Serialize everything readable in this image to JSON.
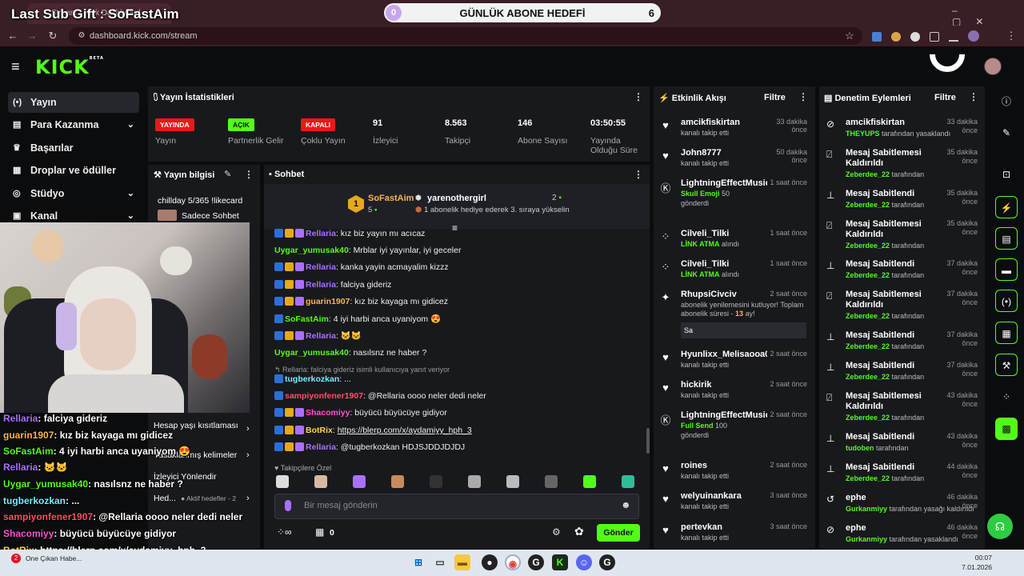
{
  "browser": {
    "tab_title": "Stream - Kick Dashboard",
    "url": "dashboard.kick.com/stream"
  },
  "overlay": {
    "sub_gift": "Last Sub Gift : SoFastAim",
    "goal_left": "0",
    "goal_title": "GÜNLÜK ABONE HEDEFİ",
    "goal_right": "6"
  },
  "sidebar": {
    "items": [
      {
        "label": "Yayın",
        "icon": "broadcast-icon"
      },
      {
        "label": "Para Kazanma",
        "icon": "wallet-icon"
      },
      {
        "label": "Başarılar",
        "icon": "trophy-icon"
      },
      {
        "label": "Droplar ve ödüller",
        "icon": "gift-icon"
      },
      {
        "label": "Stüdyo",
        "icon": "studio-icon"
      },
      {
        "label": "Kanal",
        "icon": "channel-icon"
      }
    ]
  },
  "stats": {
    "title": "Yayın İstatistikleri",
    "items": [
      {
        "tag": "YAYINDA",
        "label": "Yayın"
      },
      {
        "tag": "AÇIK",
        "label": "Partnerlik Gelir"
      },
      {
        "tag": "KAPALI",
        "label": "Çoklu Yayın"
      },
      {
        "value": "91",
        "label": "İzleyici"
      },
      {
        "value": "8.563",
        "label": "Takipçi"
      },
      {
        "value": "146",
        "label": "Abone Sayısı"
      },
      {
        "value": "03:50:55",
        "label": "Yayında Olduğu Süre"
      }
    ]
  },
  "stream_info": {
    "title": "Yayın bilgisi",
    "stream_title": "chillday 5/365 !likecard",
    "mode": "Sadece Sohbet",
    "links": [
      "Hesap yaşı kısıtlaması",
      "Yasaklanmış kelimeler",
      "İzleyici Yönlendir",
      "Hed...",
      "Aktif hedefler - 2"
    ]
  },
  "chat": {
    "title": "Sohbet",
    "leader1": "SoFastAim",
    "leader1_rank": "1",
    "leader1_count": "5",
    "leader2": "yarenothergirl",
    "leader2_count": "2",
    "leader_note": "1 abonelik hediye ederek 3. sıraya yükselin",
    "messages": [
      {
        "user": "Rellaria",
        "color": "#a970ff",
        "text": "kız biz yayın mı acıcaz"
      },
      {
        "user": "Uygar_yumusak40",
        "color": "#53fc18",
        "text": "Mrblar iyi yayınlar, iyi geceler"
      },
      {
        "user": "Rellaria",
        "color": "#a970ff",
        "text": "kanka yayin acmayalim kizzz"
      },
      {
        "user": "Rellaria",
        "color": "#a970ff",
        "text": "falciya gideriz"
      },
      {
        "user": "guarin1907",
        "color": "#ffb24d",
        "text": "kız biz kayaga mı gidicez"
      },
      {
        "user": "SoFastAim",
        "color": "#53fc18",
        "text": "4 iyi harbi anca uyaniyom 😍"
      },
      {
        "user": "Rellaria",
        "color": "#a970ff",
        "text": "🐱🐱"
      },
      {
        "user": "Uygar_yumusak40",
        "color": "#53fc18",
        "text": "nasılsnz ne haber ?"
      },
      {
        "user": "tugberkozkan",
        "color": "#79e8ff",
        "text": "..."
      },
      {
        "user": "sampiyonfener1907",
        "color": "#ff4f64",
        "text": "@Rellaria oooo neler dedi neler"
      },
      {
        "user": "Shacomiyy",
        "color": "#ff4fd2",
        "text": "büyücü büyücüye gidiyor"
      },
      {
        "user": "BotRix",
        "color": "#ffd23f",
        "text": "https://blerp.com/x/aydamiyy_hph_3"
      },
      {
        "user": "Rellaria",
        "color": "#a970ff",
        "text": "@tugberkozkan HDJSJDDJDJDJ"
      }
    ],
    "reply_note": "Rellaria: falciya gideriz isimli kullanıcıya yanıt veriyor",
    "followers_label": "Takipçilere Özel",
    "input_placeholder": "Bir mesaj gönderin",
    "points": "0",
    "send_label": "Gönder"
  },
  "activity": {
    "title": "Etkinlik Akışı",
    "filter": "Filtre",
    "items": [
      {
        "name": "amcikfiskirtan",
        "sub": "kanalı takip etti",
        "time": "33 dakika önce",
        "icon": "heart-icon"
      },
      {
        "name": "John8777",
        "sub": "kanalı takip etti",
        "time": "50 dakika önce",
        "icon": "heart-icon"
      },
      {
        "name": "LightningEffectMusic",
        "sub1": "Skull Emoji",
        "sub2": "50",
        "sub3": "gönderdi",
        "time": "1 saat önce",
        "icon": "kick-icon"
      },
      {
        "name": "Cilveli_Tilki",
        "sub1": "LİNK ATMA",
        "sub2": "alındı",
        "time": "1 saat önce",
        "icon": "points-icon"
      },
      {
        "name": "Cilveli_Tilki",
        "sub1": "LİNK ATMA",
        "sub2": "alındı",
        "time": "1 saat önce",
        "icon": "points-icon"
      },
      {
        "name": "RhupsiCivciv",
        "sub": "abonelik yenilemesini kutluyor! Toplam abonelik süresi -",
        "months": "13",
        "sub_end": "ay!",
        "message": "Sa",
        "time": "2 saat önce",
        "icon": "star-icon"
      },
      {
        "name": "Hyunlixx_Melisaooa00",
        "sub": "kanalı takip etti",
        "time": "2 saat önce",
        "icon": "heart-icon"
      },
      {
        "name": "hickirik",
        "sub": "kanalı takip etti",
        "time": "2 saat önce",
        "icon": "heart-icon"
      },
      {
        "name": "LightningEffectMusic",
        "sub1": "Full Send",
        "sub2": "100",
        "sub3": "gönderdi",
        "time": "2 saat önce",
        "icon": "kick-icon"
      },
      {
        "name": "roines",
        "sub": "kanalı takip etti",
        "time": "2 saat önce",
        "icon": "heart-icon"
      },
      {
        "name": "welyuinankara",
        "sub": "kanalı takip etti",
        "time": "3 saat önce",
        "icon": "heart-icon"
      },
      {
        "name": "pertevkan",
        "sub": "kanalı takip etti",
        "time": "3 saat önce",
        "icon": "heart-icon"
      }
    ]
  },
  "moderation": {
    "title": "Denetim Eylemleri",
    "filter": "Filtre",
    "items": [
      {
        "name": "amcikfiskirtan",
        "by": "THEYUPS",
        "suffix": "tarafından yasaklandı",
        "time": "33 dakika önce",
        "icon": "ban-icon"
      },
      {
        "name": "Mesaj Sabitlemesi Kaldırıldı",
        "by": "Zeberdee_22",
        "suffix": "tarafından",
        "time": "35 dakika önce",
        "icon": "unpin-icon"
      },
      {
        "name": "Mesaj Sabitlendi",
        "by": "Zeberdee_22",
        "suffix": "tarafından",
        "time": "35 dakika önce",
        "icon": "pin-icon"
      },
      {
        "name": "Mesaj Sabitlemesi Kaldırıldı",
        "by": "Zeberdee_22",
        "suffix": "tarafından",
        "time": "35 dakika önce",
        "icon": "unpin-icon"
      },
      {
        "name": "Mesaj Sabitlendi",
        "by": "Zeberdee_22",
        "suffix": "tarafından",
        "time": "37 dakika önce",
        "icon": "pin-icon"
      },
      {
        "name": "Mesaj Sabitlemesi Kaldırıldı",
        "by": "Zeberdee_22",
        "suffix": "tarafından",
        "time": "37 dakika önce",
        "icon": "unpin-icon"
      },
      {
        "name": "Mesaj Sabitlendi",
        "by": "Zeberdee_22",
        "suffix": "tarafından",
        "time": "37 dakika önce",
        "icon": "pin-icon"
      },
      {
        "name": "Mesaj Sabitlendi",
        "by": "Zeberdee_22",
        "suffix": "tarafından",
        "time": "37 dakika önce",
        "icon": "pin-icon"
      },
      {
        "name": "Mesaj Sabitlemesi Kaldırıldı",
        "by": "Zeberdee_22",
        "suffix": "tarafından",
        "time": "43 dakika önce",
        "icon": "unpin-icon"
      },
      {
        "name": "Mesaj Sabitlendi",
        "by": "tudoben",
        "suffix": "tarafından",
        "time": "43 dakika önce",
        "icon": "pin-icon"
      },
      {
        "name": "Mesaj Sabitlendi",
        "by": "Zeberdee_22",
        "suffix": "tarafından",
        "time": "44 dakika önce",
        "icon": "pin-icon"
      },
      {
        "name": "ephe",
        "by": "Gurkanmiyy",
        "suffix": "tarafından yasağı kaldırıldı",
        "time": "46 dakika önce",
        "icon": "unban-icon"
      },
      {
        "name": "ephe",
        "by": "Gurkanmiyy",
        "suffix": "tarafından yasaklandı",
        "time": "46 dakika önce",
        "icon": "ban-icon"
      }
    ]
  },
  "overlay_chat": [
    {
      "user": "Rellaria",
      "color": "#a970ff",
      "text": "falciya gideriz"
    },
    {
      "user": "guarin1907",
      "color": "#ffb24d",
      "text": "kız biz kayaga mı gidicez"
    },
    {
      "user": "SoFastAim",
      "color": "#53fc18",
      "text": "4 iyi harbi anca uyaniyom 😍"
    },
    {
      "user": "Rellaria",
      "color": "#a970ff",
      "text": "🐱🐱"
    },
    {
      "user": "Uygar_yumusak40",
      "color": "#53fc18",
      "text": "nasılsnz ne haber ?"
    },
    {
      "user": "tugberkozkan",
      "color": "#79e8ff",
      "text": "..."
    },
    {
      "user": "sampiyonfener1907",
      "color": "#ff4f64",
      "text": "@Rellaria oooo neler dedi neler"
    },
    {
      "user": "Shacomiyy",
      "color": "#ff4fd2",
      "text": "büyücü büyücüye gidiyor"
    },
    {
      "user": "BotRix",
      "color": "#ffd23f",
      "text": "https://blerp.com/x/aydamiyy_hph_3"
    },
    {
      "user": "Rellaria",
      "color": "#a970ff",
      "text": "@tugberkozkan HDJSJDDJDJDJ"
    }
  ],
  "taskbar": {
    "notification": "One Çıkan Habe...",
    "time": "00:07",
    "date": "7.01.2026",
    "badge": "2"
  },
  "colors": {
    "accent": "#53fc18",
    "live": "#e91916",
    "panel": "#18191d"
  }
}
